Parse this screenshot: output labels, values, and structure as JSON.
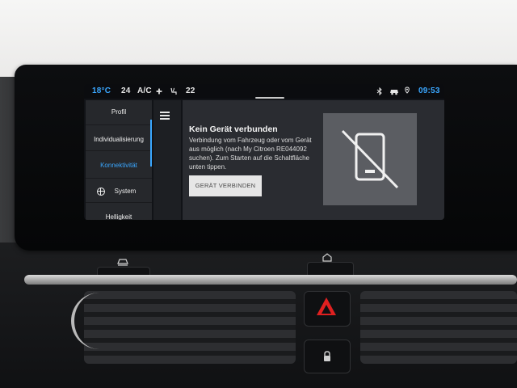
{
  "status_bar": {
    "temp_left": "18°C",
    "fan_left": "24",
    "ac_label": "A/C",
    "fan_icon": "fan-icon",
    "seat_icon": "seat-heat-icon",
    "temp_right": "22",
    "bluetooth_icon": "bluetooth-icon",
    "car_icon": "car-icon",
    "location_icon": "location-icon",
    "time": "09:53"
  },
  "sidebar": {
    "items": [
      {
        "label": "Profil"
      },
      {
        "label": "Individualisierung"
      },
      {
        "label": "Konnektivität"
      },
      {
        "label": "System"
      },
      {
        "label": "Helligkeit"
      }
    ],
    "active_index": 2,
    "accent_color": "#3aa7ff"
  },
  "content": {
    "title": "Kein Gerät verbunden",
    "description": "Verbindung vom Fahrzeug oder vom Gerät aus möglich (nach My Citroen RE044092 suchen). Zum Starten auf die Schaltfläche unten tippen.",
    "button_label": "GERÄT VERBINDEN",
    "illustration_icon": "phone-disconnected-icon"
  },
  "physical_controls": {
    "car_button_icon": "car-icon",
    "home_button_icon": "home-icon",
    "hazard_icon": "hazard-icon",
    "lock_icon": "lock-icon",
    "hazard_color": "#e02020"
  }
}
